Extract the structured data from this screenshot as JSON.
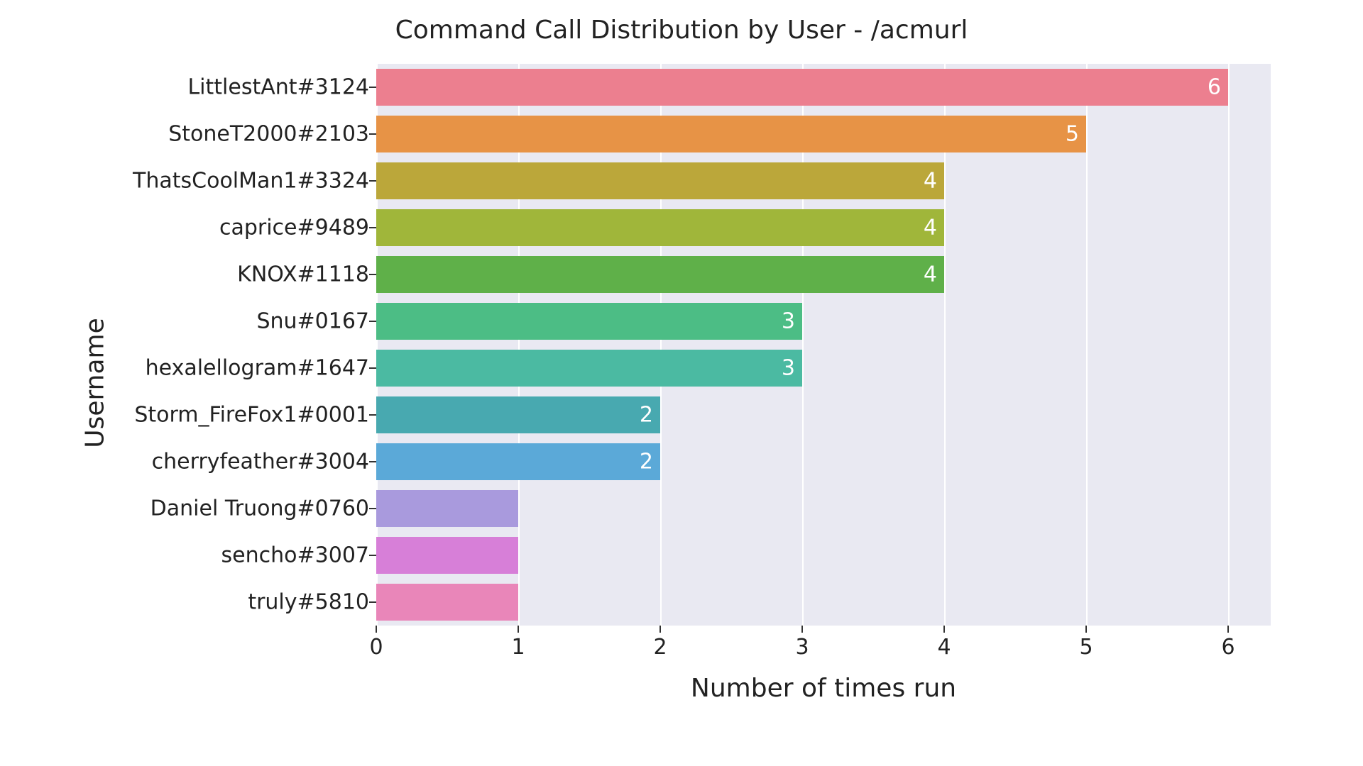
{
  "chart_data": {
    "type": "bar",
    "orientation": "horizontal",
    "title": "Command Call Distribution by User - /acmurl",
    "xlabel": "Number of times run",
    "ylabel": "Username",
    "xlim": [
      0,
      6.3
    ],
    "xticks": [
      0,
      1,
      2,
      3,
      4,
      5,
      6
    ],
    "categories": [
      "LittlestAnt#3124",
      "StoneT2000#2103",
      "ThatsCoolMan1#3324",
      "caprice#9489",
      "KNOX#1118",
      "Snu#0167",
      "hexalellogram#1647",
      "Storm_FireFox1#0001",
      "cherryfeather#3004",
      "Daniel Truong#0760",
      "sencho#3007",
      "truly#5810"
    ],
    "values": [
      6,
      5,
      4,
      4,
      4,
      3,
      3,
      2,
      2,
      1,
      1,
      1
    ],
    "colors": [
      "#ec7f8f",
      "#e79346",
      "#bba73a",
      "#a0b63a",
      "#5fb049",
      "#4cbd85",
      "#4bbaa2",
      "#48a9b0",
      "#5ba9d8",
      "#a99add",
      "#d77fd8",
      "#e986b9"
    ],
    "grid": true
  }
}
